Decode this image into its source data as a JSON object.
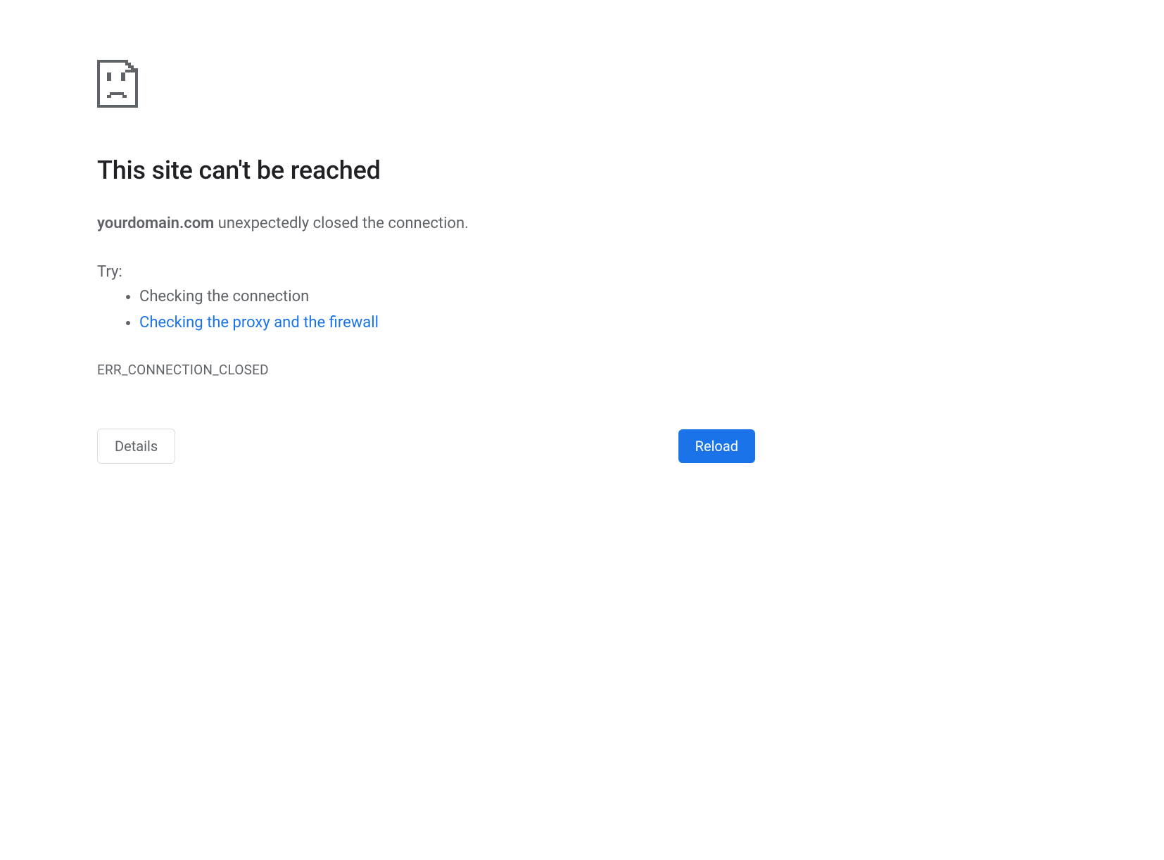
{
  "heading": "This site can't be reached",
  "domain": "yourdomain.com",
  "message_suffix": " unexpectedly closed the connection.",
  "try_label": "Try:",
  "suggestions": {
    "item0": "Checking the connection",
    "item1": "Checking the proxy and the firewall"
  },
  "error_code": "ERR_CONNECTION_CLOSED",
  "buttons": {
    "details": "Details",
    "reload": "Reload"
  },
  "colors": {
    "link": "#1a73e8",
    "primary_button": "#1a73e8",
    "text_primary": "#202124",
    "text_secondary": "#5f6368",
    "border": "#dadce0"
  }
}
